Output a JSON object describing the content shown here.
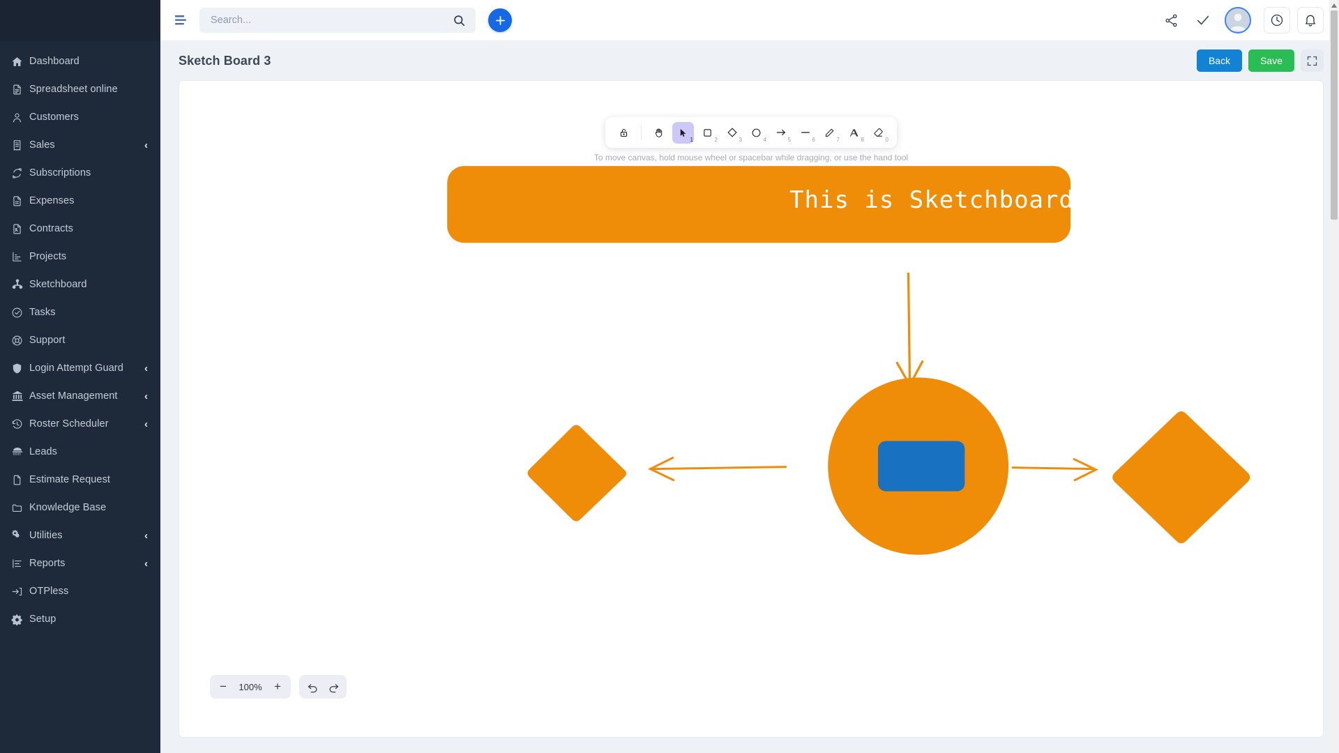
{
  "sidebar": {
    "items": [
      {
        "label": "Dashboard",
        "icon": "home-icon",
        "caret": false
      },
      {
        "label": "Spreadsheet online",
        "icon": "document-icon",
        "caret": false
      },
      {
        "label": "Customers",
        "icon": "user-icon",
        "caret": false
      },
      {
        "label": "Sales",
        "icon": "receipt-icon",
        "caret": true
      },
      {
        "label": "Subscriptions",
        "icon": "refresh-cycle-icon",
        "caret": false
      },
      {
        "label": "Expenses",
        "icon": "document-lines-icon",
        "caret": false
      },
      {
        "label": "Contracts",
        "icon": "contract-icon",
        "caret": false
      },
      {
        "label": "Projects",
        "icon": "chart-bars-icon",
        "caret": false
      },
      {
        "label": "Sketchboard",
        "icon": "sketchboard-icon",
        "caret": false
      },
      {
        "label": "Tasks",
        "icon": "check-circle-icon",
        "caret": false
      },
      {
        "label": "Support",
        "icon": "lifebuoy-icon",
        "caret": false
      },
      {
        "label": "Login Attempt Guard",
        "icon": "shield-icon",
        "caret": true
      },
      {
        "label": "Asset Management",
        "icon": "bank-icon",
        "caret": true
      },
      {
        "label": "Roster Scheduler",
        "icon": "history-clock-icon",
        "caret": true
      },
      {
        "label": "Leads",
        "icon": "telephone-icon",
        "caret": false
      },
      {
        "label": "Estimate Request",
        "icon": "file-icon",
        "caret": false
      },
      {
        "label": "Knowledge Base",
        "icon": "folder-icon",
        "caret": false
      },
      {
        "label": "Utilities",
        "icon": "gears-icon",
        "caret": true
      },
      {
        "label": "Reports",
        "icon": "report-list-icon",
        "caret": true
      },
      {
        "label": "OTPless",
        "icon": "login-arrow-icon",
        "caret": false
      },
      {
        "label": "Setup",
        "icon": "gear-icon",
        "caret": false
      }
    ],
    "caret_glyph": "‹"
  },
  "header": {
    "menu_icon": "hamburger-menu-icon",
    "search": {
      "placeholder": "Search...",
      "value": ""
    },
    "search_icon": "magnifier-icon",
    "add_icon": "plus-icon",
    "icons": [
      {
        "name": "share-icon"
      },
      {
        "name": "check-icon"
      },
      {
        "name": "avatar"
      },
      {
        "name": "clock-icon"
      },
      {
        "name": "bell-icon"
      }
    ]
  },
  "page": {
    "title": "Sketch Board 3",
    "back_label": "Back",
    "save_label": "Save",
    "fullscreen_icon": "expand-icon"
  },
  "sketch_toolbar": {
    "hint": "To move canvas, hold mouse wheel or spacebar while dragging, or use the hand tool",
    "tools": [
      {
        "name": "lock-tool",
        "key": "",
        "active": false
      },
      {
        "name": "hand-tool",
        "key": "",
        "active": false
      },
      {
        "name": "selection-tool",
        "key": "1",
        "active": true
      },
      {
        "name": "rectangle-tool",
        "key": "2",
        "active": false
      },
      {
        "name": "diamond-tool",
        "key": "3",
        "active": false
      },
      {
        "name": "ellipse-tool",
        "key": "4",
        "active": false
      },
      {
        "name": "arrow-tool",
        "key": "5",
        "active": false
      },
      {
        "name": "line-tool",
        "key": "6",
        "active": false
      },
      {
        "name": "draw-tool",
        "key": "7",
        "active": false
      },
      {
        "name": "text-tool",
        "key": "8",
        "active": false
      },
      {
        "name": "eraser-tool",
        "key": "0",
        "active": false
      }
    ]
  },
  "zoom_controls": {
    "minus_label": "−",
    "level": "100%",
    "plus_label": "+",
    "undo_icon": "undo-icon",
    "redo_icon": "redo-icon"
  },
  "canvas": {
    "banner_text": "This is Sketchboard",
    "colors": {
      "orange": "#ef8d08",
      "blue": "#1971c2",
      "canvas_bg": "#ffffff"
    },
    "shapes": [
      {
        "name": "banner-rectangle",
        "type": "rectangle",
        "fill": "#ef8d08"
      },
      {
        "name": "down-arrow",
        "type": "arrow",
        "stroke": "#ef8d08"
      },
      {
        "name": "center-ellipse",
        "type": "ellipse",
        "fill": "#ef8d08"
      },
      {
        "name": "inner-rectangle",
        "type": "rectangle",
        "fill": "#1971c2"
      },
      {
        "name": "left-diamond",
        "type": "diamond",
        "fill": "#ef8d08"
      },
      {
        "name": "right-diamond",
        "type": "diamond",
        "fill": "#ef8d08"
      },
      {
        "name": "left-arrow",
        "type": "arrow",
        "stroke": "#ef8d08"
      },
      {
        "name": "right-arrow",
        "type": "arrow",
        "stroke": "#ef8d08"
      }
    ]
  }
}
